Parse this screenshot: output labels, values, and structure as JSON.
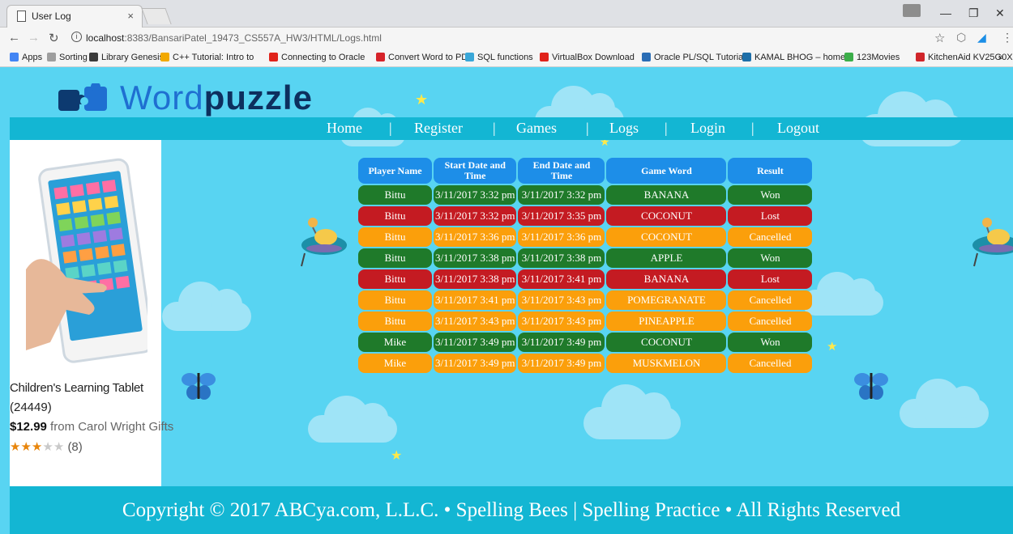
{
  "browser": {
    "tab_title": "User Log",
    "tab_close": "×",
    "url_host": "localhost",
    "url_path": ":8383/BansariPatel_19473_CS557A_HW3/HTML/Logs.html",
    "bookmarks": [
      {
        "label": "Apps",
        "color": "#4285f4"
      },
      {
        "label": "Sorting",
        "color": "#9e9e9e"
      },
      {
        "label": "Library Genesis",
        "color": "#3b3b3b"
      },
      {
        "label": "C++ Tutorial: Intro to",
        "color": "#f2a900"
      },
      {
        "label": "Connecting to Oracle",
        "color": "#e0231b"
      },
      {
        "label": "Convert Word to PDF",
        "color": "#d6232a"
      },
      {
        "label": "SQL functions",
        "color": "#3aa7d8"
      },
      {
        "label": "VirtualBox Download",
        "color": "#e0231b"
      },
      {
        "label": "Oracle PL/SQL Tutoria",
        "color": "#2a6db5"
      },
      {
        "label": "KAMAL BHOG – home",
        "color": "#1e6fa8"
      },
      {
        "label": "123Movies",
        "color": "#3cae4a"
      },
      {
        "label": "KitchenAid KV25G0X",
        "color": "#d0252a"
      }
    ],
    "more_bookmarks": "»"
  },
  "site": {
    "logo_light": "Word",
    "logo_bold": "puzzle",
    "nav": [
      "Home",
      "Register",
      "Games",
      "Logs",
      "Login",
      "Logout"
    ],
    "nav_separator": "|"
  },
  "ad": {
    "title": "Children's Learning Tablet",
    "review_count": "(24449)",
    "price": "$12.99",
    "seller": " from Carol Wright Gifts",
    "rating": 3,
    "rating_max": 5,
    "rating_count": "(8)"
  },
  "log_table": {
    "headers": [
      "Player Name",
      "Start Date and Time",
      "End Date and Time",
      "Game Word",
      "Result"
    ],
    "rows": [
      {
        "player": "Bittu",
        "start": "3/11/2017 3:32 pm",
        "end": "3/11/2017 3:32 pm",
        "word": "BANANA",
        "result": "Won",
        "status": "won"
      },
      {
        "player": "Bittu",
        "start": "3/11/2017 3:32 pm",
        "end": "3/11/2017 3:35 pm",
        "word": "COCONUT",
        "result": "Lost",
        "status": "lost"
      },
      {
        "player": "Bittu",
        "start": "3/11/2017 3:36 pm",
        "end": "3/11/2017 3:36 pm",
        "word": "COCONUT",
        "result": "Cancelled",
        "status": "cancelled"
      },
      {
        "player": "Bittu",
        "start": "3/11/2017 3:38 pm",
        "end": "3/11/2017 3:38 pm",
        "word": "APPLE",
        "result": "Won",
        "status": "won"
      },
      {
        "player": "Bittu",
        "start": "3/11/2017 3:38 pm",
        "end": "3/11/2017 3:41 pm",
        "word": "BANANA",
        "result": "Lost",
        "status": "lost"
      },
      {
        "player": "Bittu",
        "start": "3/11/2017 3:41 pm",
        "end": "3/11/2017 3:43 pm",
        "word": "POMEGRANATE",
        "result": "Cancelled",
        "status": "cancelled"
      },
      {
        "player": "Bittu",
        "start": "3/11/2017 3:43 pm",
        "end": "3/11/2017 3:43 pm",
        "word": "PINEAPPLE",
        "result": "Cancelled",
        "status": "cancelled"
      },
      {
        "player": "Mike",
        "start": "3/11/2017 3:49 pm",
        "end": "3/11/2017 3:49 pm",
        "word": "COCONUT",
        "result": "Won",
        "status": "won"
      },
      {
        "player": "Mike",
        "start": "3/11/2017 3:49 pm",
        "end": "3/11/2017 3:49 pm",
        "word": "MUSKMELON",
        "result": "Cancelled",
        "status": "cancelled"
      }
    ]
  },
  "colors": {
    "won": "#1f7a2a",
    "lost": "#c41b22",
    "cancelled": "#fb9f0b",
    "header": "#1d8ee8",
    "background": "#58d4f2",
    "navbar": "#13b6d3"
  },
  "footer": {
    "text": "Copyright © 2017 ABCya.com, L.L.C. • Spelling Bees | Spelling Practice • All Rights Reserved"
  }
}
